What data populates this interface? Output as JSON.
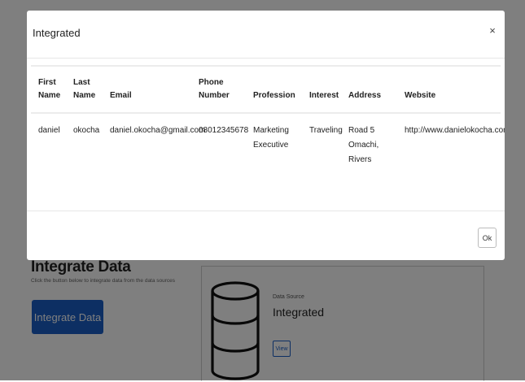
{
  "page": {
    "integrate": {
      "title": "Integrate Data",
      "description": "Click the button below to integrate data from the data sources",
      "button_label": "Integrate Data"
    },
    "source": {
      "label": "Data Source",
      "value": "Integrated",
      "view_label": "View",
      "icon": "database-icon"
    }
  },
  "modal": {
    "title": "Integrated",
    "close_label": "×",
    "ok_label": "Ok",
    "columns": [
      "First Name",
      "Last Name",
      "Email",
      "Phone Number",
      "Profession",
      "Interest",
      "Address",
      "Website"
    ],
    "rows": [
      {
        "first_name": "daniel",
        "last_name": "okocha",
        "email": "daniel.okocha@gmail.com",
        "phone": "08012345678",
        "profession": "Marketing Executive",
        "interest": "Traveling",
        "address": "Road 5 Omachi, Rivers",
        "website": "http://www.danielokocha.com"
      }
    ]
  },
  "colors": {
    "primary": "#1a5fc6",
    "backdrop": "rgba(0,0,0,0.5)"
  }
}
